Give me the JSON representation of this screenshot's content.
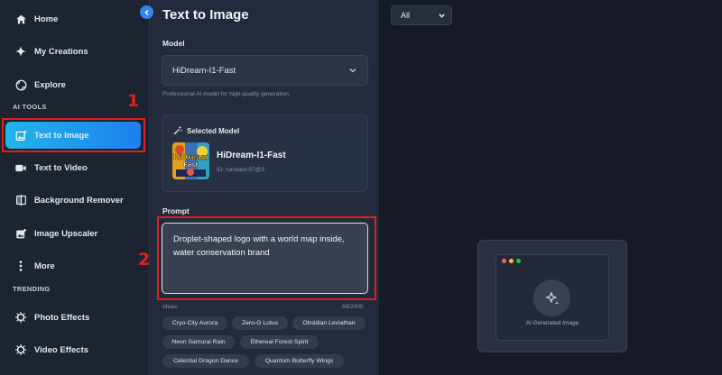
{
  "sidebar": {
    "items": [
      {
        "label": "Home",
        "icon": "home-icon"
      },
      {
        "label": "My Creations",
        "icon": "sparkle-icon"
      },
      {
        "label": "Explore",
        "icon": "globe-icon"
      }
    ],
    "ai_tools_label": "AI TOOLS",
    "ai_tools": [
      {
        "label": "Text to Image",
        "icon": "image-add-icon",
        "active": true
      },
      {
        "label": "Text to Video",
        "icon": "video-icon"
      },
      {
        "label": "Background Remover",
        "icon": "split-frame-icon"
      },
      {
        "label": "Image Upscaler",
        "icon": "upscale-image-icon"
      },
      {
        "label": "More",
        "icon": "more-vertical-icon"
      }
    ],
    "trending_label": "TRENDING",
    "trending": [
      {
        "label": "Photo Effects",
        "icon": "photo-effects-icon"
      },
      {
        "label": "Video Effects",
        "icon": "video-effects-icon"
      }
    ]
  },
  "annotations": {
    "one": "1",
    "two": "2"
  },
  "main": {
    "title": "Text to Image",
    "model_label": "Model",
    "model_value": "HiDream-I1-Fast",
    "model_description": "Professional AI model for high-quality generation.",
    "selected_model": {
      "heading": "Selected Model",
      "name": "HiDream-I1-Fast",
      "id": "ID: runware:97@3",
      "thumb_text": "HiDream Fast"
    },
    "prompt_label": "Prompt",
    "prompt_text": "Droplet-shaped logo with a world map inside, water conservation brand",
    "ideas_label": "Ideas:",
    "char_count": "69/2000",
    "ideas": [
      "Cryo-City Aurora",
      "Zero-G Lotus",
      "Obsidian Leviathan",
      "Neon Samurai Rain",
      "Ethereal Forest Spirit",
      "Celestial Dragon Dance",
      "Quantum Butterfly Wings"
    ]
  },
  "canvas": {
    "filter_value": "All",
    "placeholder_label": "AI Generated Image"
  },
  "colors": {
    "accent": "#1e8ef0",
    "annotation": "#e02020",
    "window_dots": [
      "#ff5f57",
      "#febc2e",
      "#28c840"
    ]
  }
}
